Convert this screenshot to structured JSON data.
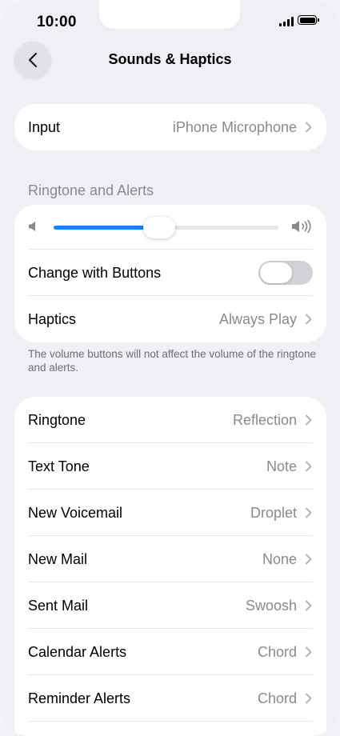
{
  "status_bar": {
    "time": "10:00",
    "signal_icon": "signal-bars-icon",
    "battery_icon": "battery-icon"
  },
  "nav": {
    "title": "Sounds & Haptics",
    "back_icon": "chevron-left-icon"
  },
  "input": {
    "label": "Input",
    "value": "iPhone Microphone"
  },
  "ringtone_alerts": {
    "header": "Ringtone and Alerts",
    "volume_level": 0.47,
    "change_with_buttons": {
      "label": "Change with Buttons",
      "on": false
    },
    "haptics": {
      "label": "Haptics",
      "value": "Always Play"
    },
    "footnote": "The volume buttons will not affect the volume of the ringtone and alerts."
  },
  "sounds": [
    {
      "label": "Ringtone",
      "value": "Reflection"
    },
    {
      "label": "Text Tone",
      "value": "Note"
    },
    {
      "label": "New Voicemail",
      "value": "Droplet"
    },
    {
      "label": "New Mail",
      "value": "None"
    },
    {
      "label": "Sent Mail",
      "value": "Swoosh"
    },
    {
      "label": "Calendar Alerts",
      "value": "Chord"
    },
    {
      "label": "Reminder Alerts",
      "value": "Chord"
    }
  ],
  "colors": {
    "accent": "#0a84ff",
    "background": "#efeff4",
    "secondary_text": "#8a8a8e"
  }
}
